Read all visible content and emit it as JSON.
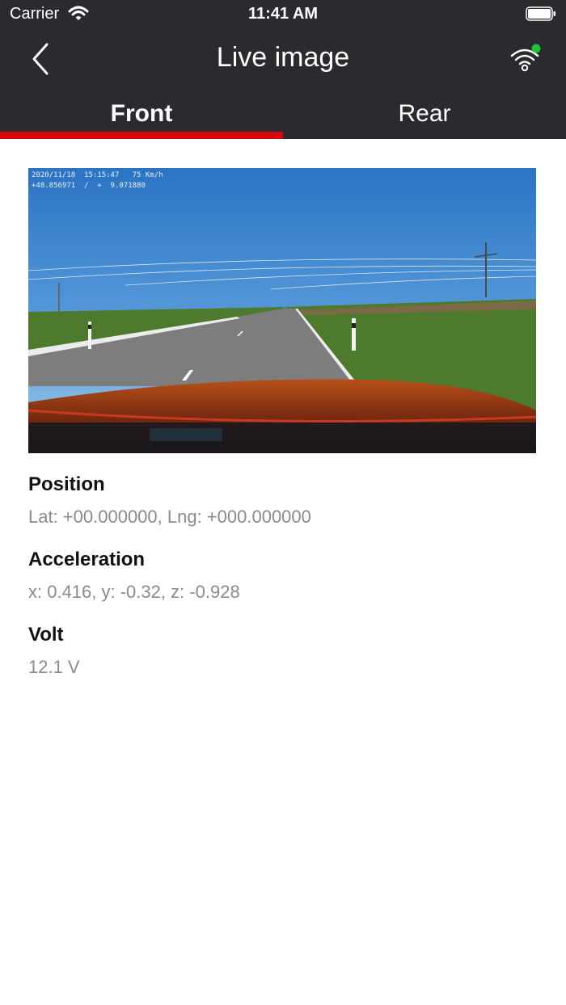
{
  "status_bar": {
    "carrier": "Carrier",
    "time": "11:41 AM"
  },
  "nav": {
    "title": "Live image"
  },
  "tabs": [
    {
      "label": "Front",
      "selected": true
    },
    {
      "label": "Rear",
      "selected": false
    }
  ],
  "camera": {
    "overlay_line1": "2020/11/18  15:15:47   75 Km/h",
    "overlay_line2": "+48.856971  /  +  9.071880"
  },
  "info": {
    "position": {
      "label": "Position",
      "value": "Lat: +00.000000, Lng: +000.000000"
    },
    "acceleration": {
      "label": "Acceleration",
      "value": "x: 0.416, y: -0.32, z: -0.928"
    },
    "volt": {
      "label": "Volt",
      "value": "12.1 V"
    }
  },
  "colors": {
    "header_bg": "#2a2b2e",
    "accent_red": "#d8060d",
    "connected_green": "#1fc23a",
    "secondary_text": "#8a8a8f"
  }
}
